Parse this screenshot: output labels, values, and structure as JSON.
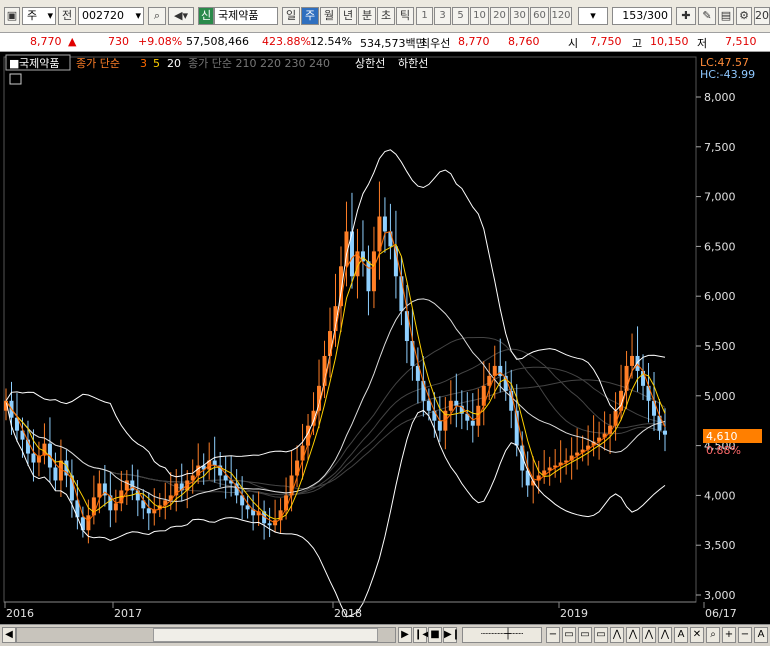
{
  "toolbar": {
    "market": "주",
    "prev_label": "전",
    "code": "002720",
    "stock_badge": "신",
    "stock_name": "국제약품",
    "periods": [
      "일",
      "주",
      "월",
      "년",
      "분",
      "초",
      "틱"
    ],
    "selected_period": "주",
    "intervals": [
      "1",
      "3",
      "5",
      "10",
      "20",
      "30",
      "60",
      "120"
    ],
    "count": "153",
    "count_total": "/300",
    "right_label": "20"
  },
  "quote": {
    "price": "8,770",
    "change": "730",
    "change_pct": "+9.08%",
    "volume": "57,508,466",
    "volume_ratio": "423.88%",
    "turnover": "12.54%",
    "amount": "534,573백만",
    "sell_label": "최우선",
    "ask": "8,770",
    "bid": "8,760",
    "open_label": "시",
    "open": "7,750",
    "high_label": "고",
    "high": "10,150",
    "low_label": "저",
    "low": "7,510"
  },
  "legend": {
    "name": "국제약품",
    "ma_label": "종가 단순",
    "ma_periods": [
      "3",
      "5",
      "20"
    ],
    "ma_long": "종가 단순 210  220  230  240",
    "upper": "상한선",
    "lower": "하한선",
    "lc": "LC:47.57",
    "hc": "HC:-43.99"
  },
  "colors": {
    "up": "#ff7f27",
    "down": "#8fd0ff",
    "ma3": "#ff6a00",
    "ma5": "#ffd000",
    "band": "#ffffff",
    "price_tag": "#ff7f00"
  },
  "chart_data": {
    "type": "candlestick",
    "ylim": [
      3000,
      8150
    ],
    "yticks": [
      3000,
      3500,
      4000,
      4500,
      5000,
      5500,
      6000,
      6500,
      7000,
      7500,
      8000
    ],
    "ytick_labels": [
      "3,000",
      "3,500",
      "4,000",
      "4,500",
      "5,000",
      "5,500",
      "6,000",
      "6,500",
      "7,000",
      "7,500",
      "8,000"
    ],
    "xticks": [
      "2016",
      "2017",
      "2018",
      "2019",
      "06/17"
    ],
    "current_price": "4,610",
    "current_pct": "0.88%",
    "closes": [
      4950,
      4780,
      4650,
      4560,
      4420,
      4330,
      4400,
      4520,
      4280,
      4150,
      4350,
      4200,
      3950,
      3780,
      3650,
      3800,
      3980,
      4120,
      4000,
      3850,
      3920,
      4050,
      4150,
      4050,
      3950,
      3870,
      3820,
      3860,
      3900,
      3950,
      4000,
      4120,
      4050,
      4150,
      4200,
      4300,
      4260,
      4350,
      4300,
      4200,
      4150,
      4120,
      4000,
      3900,
      3860,
      3800,
      3840,
      3720,
      3700,
      3750,
      3850,
      4000,
      4200,
      4350,
      4500,
      4700,
      4850,
      5100,
      5400,
      5650,
      5900,
      6300,
      6650,
      6200,
      6450,
      6350,
      6050,
      6450,
      6800,
      6650,
      6500,
      6200,
      5850,
      5550,
      5300,
      5150,
      4950,
      4850,
      4750,
      4650,
      4850,
      4950,
      4900,
      4820,
      4750,
      4700,
      4900,
      5100,
      5200,
      5300,
      5200,
      5050,
      4850,
      4500,
      4250,
      4100,
      4150,
      4200,
      4250,
      4280,
      4300,
      4330,
      4350,
      4400,
      4430,
      4460,
      4500,
      4540,
      4580,
      4620,
      4700,
      4850,
      5050,
      5300,
      5400,
      5250,
      5100,
      4950,
      4800,
      4650,
      4610
    ]
  }
}
